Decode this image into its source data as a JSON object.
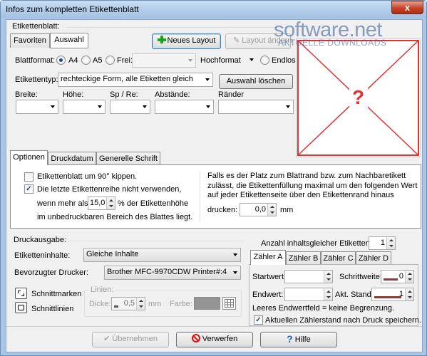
{
  "window": {
    "title": "Infos zum kompletten Etikettenblatt",
    "close_symbol": "x"
  },
  "watermark": {
    "brand": "software.net",
    "tagline": "AKTUELLE DOWNLOADS"
  },
  "sheet": {
    "section_label": "Etikettenblatt:",
    "tabs": [
      "Favoriten",
      "Auswahl"
    ],
    "active_tab": "Auswahl",
    "new_layout_button": "Neues Layout",
    "save_layout_button": "Layout ändern",
    "format_label": "Blattformat:",
    "format_a4": "A4",
    "format_a5": "A5",
    "format_free": "Frei:",
    "format_selected": "A4",
    "free_value": "",
    "orientation": "Hochformat",
    "endless": "Endlos",
    "type_label": "Etikettentyp:",
    "type_value": "rechteckige Form, alle Etiketten gleich",
    "clear_selection_button": "Auswahl löschen",
    "dim_headers": [
      "Breite:",
      "Höhe:",
      "Sp / Re:",
      "Abstände:",
      "Ränder"
    ],
    "dim_values": [
      "",
      "",
      "",
      "",
      ""
    ]
  },
  "preview": {
    "symbol": "?",
    "accent_color": "#e53030"
  },
  "options": {
    "tabs": [
      "Optionen",
      "Druckdatum",
      "Generelle Schrift"
    ],
    "active_tab": "Optionen",
    "rotate_label": "Etikettenblatt um 90° kippen.",
    "rotate_checked": false,
    "lastrow_label": "Die letzte Etikettenreihe nicht verwenden,",
    "lastrow_checked": true,
    "lastrow_when": "wenn mehr als",
    "lastrow_value": "15,0",
    "lastrow_suffix": "% der Etikettenhöhe",
    "lastrow_line3": "im unbedruckbaren Bereich des Blattes liegt.",
    "info_text": "Falls es der Platz zum Blattrand bzw. zum Nachbaretikett zulässt, die Etikettenfüllung maximal um den folgenden Wert auf jeder Etikettenseite über den Etikettenrand hinaus",
    "print_label": "drucken:",
    "print_value": "0,0",
    "print_unit": "mm"
  },
  "output": {
    "section_label": "Druckausgabe:",
    "content_label": "Etiketteninhalte:",
    "content_value": "Gleiche Inhalte",
    "printer_label": "Bevorzugter Drucker:",
    "printer_value": "Brother MFC-9970CDW Printer#:4",
    "cutmarks_label": "Schnittmarken",
    "cutlines_label": "Schnittlinien",
    "lines_label": "Linien:",
    "thickness_label": "Dicke:",
    "thickness_value": "0,5",
    "thickness_unit": "mm",
    "color_label": "Farbe:"
  },
  "counter": {
    "same_content_label": "Anzahl inhaltsgleicher Etiketten:",
    "same_content_value": "1",
    "tabs": [
      "Zähler A",
      "Zähler B",
      "Zähler C",
      "Zähler D"
    ],
    "active_tab": "Zähler A",
    "start_label": "Startwert:",
    "start_value": "",
    "step_label": "Schrittweite:",
    "step_value": "0",
    "end_label": "Endwert:",
    "end_value": "",
    "current_label": "Akt. Stand:",
    "current_value": "1",
    "empty_hint": "Leeres Endwertfeld = keine Begrenzung.",
    "save_label": "Aktuellen Zählerstand nach Druck speichern.",
    "save_checked": true
  },
  "footer": {
    "apply_button": "Übernehmen",
    "discard_button": "Verwerfen",
    "help_button": "Hilfe"
  }
}
